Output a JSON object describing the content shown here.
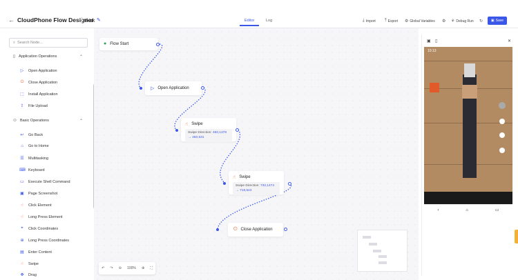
{
  "header": {
    "title": "CloudPhone Flow Designer",
    "project": "tikok",
    "tabs": [
      {
        "label": "Editor",
        "active": true
      },
      {
        "label": "Log",
        "active": false
      }
    ],
    "actions": [
      {
        "label": "Import",
        "icon": "import-icon"
      },
      {
        "label": "Export",
        "icon": "export-icon"
      },
      {
        "label": "Global Variables",
        "icon": "gear-icon"
      }
    ],
    "debug_label": "Debug Run",
    "save_label": "Save",
    "accent": "#3a57e8"
  },
  "sidebar": {
    "search_placeholder": "Search Node...",
    "sections": [
      {
        "label": "Application Operations",
        "items": [
          "Open Application",
          "Close Application",
          "Install Application",
          "File Upload"
        ]
      },
      {
        "label": "Basic Operations",
        "items": [
          "Go Back",
          "Go to Home",
          "Multitasking",
          "Keyboard",
          "Execute Shell Command",
          "Page Screenshot",
          "Click Element",
          "Long Press Element",
          "Click Coordinates",
          "Long Press Coordinates",
          "Enter Content",
          "Swipe",
          "Drag"
        ]
      }
    ]
  },
  "nodes": {
    "start": {
      "label": "Flow Start"
    },
    "open": {
      "label": "Open Application"
    },
    "swipe1": {
      "label": "Swipe",
      "detail_key": "Swipe Direction: ",
      "detail_val": "460,1378 → 460,531"
    },
    "swipe2": {
      "label": "Swipe",
      "detail_key": "Swipe Direction: ",
      "detail_val": "732,1474 → 718,524"
    },
    "close": {
      "label": "Close Application"
    }
  },
  "zoom": {
    "level": "100%"
  },
  "phone": {
    "time": "10:13"
  }
}
